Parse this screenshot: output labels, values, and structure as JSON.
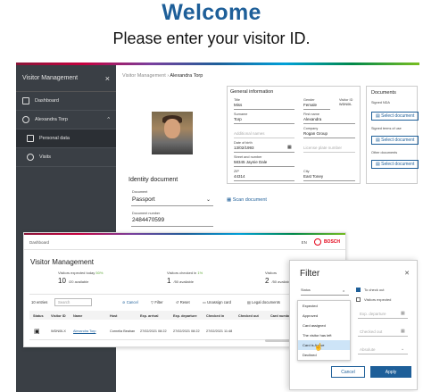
{
  "header": {
    "title": "Welcome",
    "subtitle": "Please enter your visitor ID."
  },
  "back_window": {
    "sidebar": {
      "app_title": "Visitor Management",
      "items": [
        {
          "label": "Dashboard",
          "icon": "home-icon"
        },
        {
          "label": "Alexandra Torp",
          "icon": "person-icon"
        },
        {
          "label": "Personal data",
          "icon": "id-card-icon"
        },
        {
          "label": "Visits",
          "icon": "clock-icon"
        }
      ]
    },
    "breadcrumb": {
      "root": "Visitor Management",
      "current": "Alexandra Torp"
    },
    "identity": {
      "title": "Identity document",
      "doc_label": "Document",
      "doc_value": "Passport",
      "scan_label": "Scan document",
      "number_label": "Document number",
      "number_value": "2484470599"
    },
    "general": {
      "title": "General information",
      "fields": [
        {
          "label": "Title",
          "value": "Miss"
        },
        {
          "label": "Gender",
          "value": "Female"
        },
        {
          "label": "Visitor ID",
          "value": "WDN0IL"
        },
        {
          "label": "Surname",
          "value": "Torp"
        },
        {
          "label": "First name",
          "value": "Alexandra"
        },
        {
          "label": "Company",
          "value": "Rogan Group"
        },
        {
          "label": "Date of birth",
          "value": "13/02/1993"
        },
        {
          "label": "Street and number",
          "value": "58345 Jaynie Dale"
        },
        {
          "label": "ZIP",
          "value": "44314"
        },
        {
          "label": "City",
          "value": "East Toney"
        }
      ],
      "ghost_fields": [
        "Additional names",
        "License plate number"
      ]
    },
    "documents": {
      "title": "Documents",
      "groups": [
        {
          "label": "Signed NDA",
          "button": "Select document"
        },
        {
          "label": "Signed terms of use",
          "button": "Select document"
        },
        {
          "label": "Other documents",
          "button": "Select document"
        }
      ]
    }
  },
  "front_window": {
    "crumb": "Dashboard",
    "lang": "EN",
    "brand": "BOSCH",
    "title": "Visitor Management",
    "stats": [
      {
        "label": "Visitors expected today",
        "pct": "50%",
        "count": "10",
        "suffix": "/20 available"
      },
      {
        "label": "Visitors checked in",
        "pct": "1%",
        "count": "1",
        "suffix": "/50 available"
      },
      {
        "label": "Visitors",
        "pct": "",
        "count": "2",
        "suffix": "/50 available"
      }
    ],
    "toolbar": {
      "entries": "10 entries",
      "search": "Search",
      "cancel": "Cancel",
      "filter": "Filter",
      "reset": "Reset",
      "unassign": "Unassign card",
      "legal": "Legal documents"
    },
    "columns": [
      "Status",
      "Visitor ID",
      "Name",
      "Host",
      "Exp. arrival",
      "Exp. departure",
      "Checked in",
      "Checked out",
      "Card number"
    ],
    "row": [
      "WDN0ILX",
      "Alexandra Torp",
      "Cornelia Beahan",
      "27/02/2021 08:22",
      "27/02/2021 08:22",
      "27/02/2021 11:48",
      "",
      ""
    ]
  },
  "filter": {
    "title": "Filter",
    "status_label": "Status",
    "options": [
      "Expected",
      "Approved",
      "Card assigned",
      "The visitor has left",
      "Card is Active",
      "Declined"
    ],
    "highlighted": "Card is Active",
    "checks": [
      {
        "label": "To check out",
        "checked": true
      },
      {
        "label": "Visitors expected",
        "checked": false
      }
    ],
    "fields": [
      "Exp. departure",
      "Checked out",
      "Absolute"
    ],
    "cancel": "Cancel",
    "apply": "Apply"
  }
}
